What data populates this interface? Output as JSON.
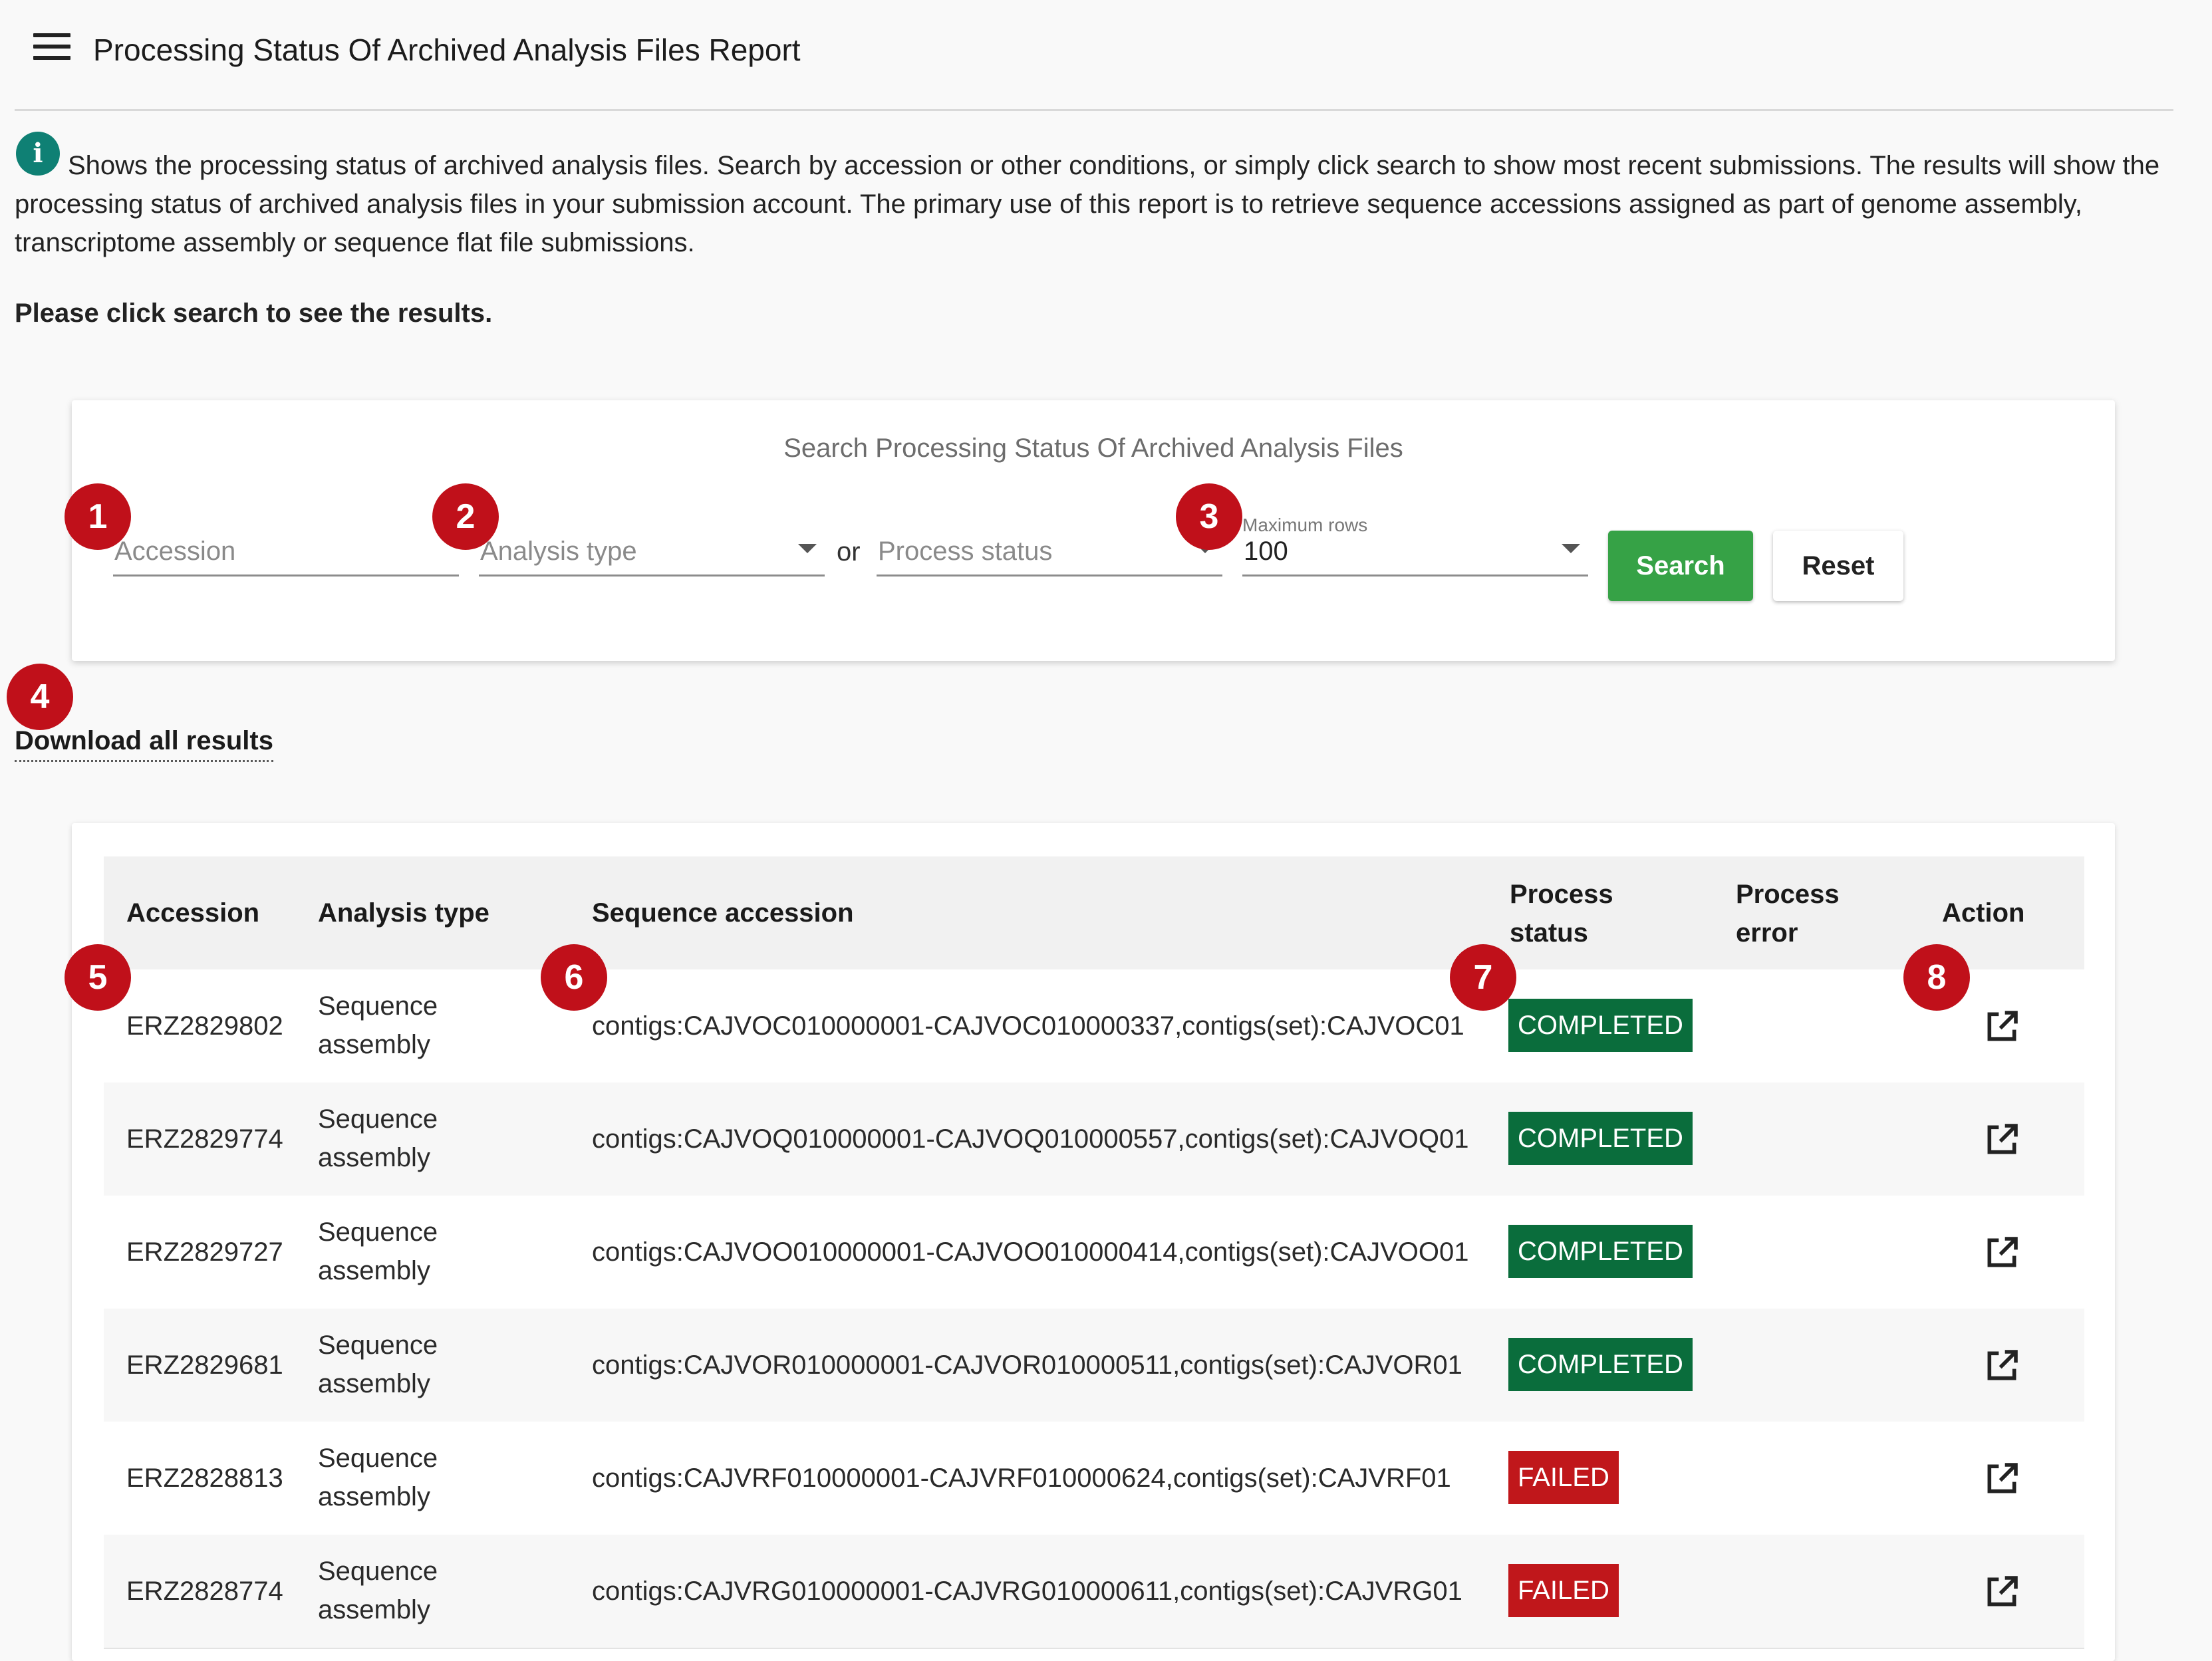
{
  "header": {
    "title": "Processing Status Of Archived Analysis Files Report",
    "menu_icon": "hamburger-menu-icon"
  },
  "intro": {
    "info_icon": "info-icon",
    "description": "Shows the processing status of archived analysis files. Search by accession or other conditions, or simply click search to show most recent submissions. The results will show the processing status of archived analysis files in your submission account. The primary use of this report is to retrieve sequence accessions assigned as part of genome assembly, transcriptome assembly or sequence flat file submissions.",
    "instruction": "Please click search to see the results."
  },
  "search": {
    "title": "Search Processing Status Of Archived Analysis Files",
    "accession_placeholder": "Accession",
    "analysis_type_placeholder": "Analysis type",
    "or_label": "or",
    "process_status_placeholder": "Process status",
    "max_rows_label": "Maximum rows",
    "max_rows_value": "100",
    "search_button": "Search",
    "reset_button": "Reset"
  },
  "download_link": "Download all results",
  "table": {
    "headers": {
      "accession": "Accession",
      "analysis_type": "Analysis type",
      "sequence_accession": "Sequence accession",
      "process_status": "Process status",
      "process_error": "Process error",
      "action": "Action"
    },
    "rows": [
      {
        "accession": "ERZ2829802",
        "analysis_type": "Sequence assembly",
        "sequence_accession": "contigs:CAJVOC010000001-CAJVOC010000337,contigs(set):CAJVOC01",
        "status": "COMPLETED",
        "error": ""
      },
      {
        "accession": "ERZ2829774",
        "analysis_type": "Sequence assembly",
        "sequence_accession": "contigs:CAJVOQ010000001-CAJVOQ010000557,contigs(set):CAJVOQ01",
        "status": "COMPLETED",
        "error": ""
      },
      {
        "accession": "ERZ2829727",
        "analysis_type": "Sequence assembly",
        "sequence_accession": "contigs:CAJVOO010000001-CAJVOO010000414,contigs(set):CAJVOO01",
        "status": "COMPLETED",
        "error": ""
      },
      {
        "accession": "ERZ2829681",
        "analysis_type": "Sequence assembly",
        "sequence_accession": "contigs:CAJVOR010000001-CAJVOR010000511,contigs(set):CAJVOR01",
        "status": "COMPLETED",
        "error": ""
      },
      {
        "accession": "ERZ2828813",
        "analysis_type": "Sequence assembly",
        "sequence_accession": "contigs:CAJVRF010000001-CAJVRF010000624,contigs(set):CAJVRF01",
        "status": "FAILED",
        "error": ""
      },
      {
        "accession": "ERZ2828774",
        "analysis_type": "Sequence assembly",
        "sequence_accession": "contigs:CAJVRG010000001-CAJVRG010000611,contigs(set):CAJVRG01",
        "status": "FAILED",
        "error": ""
      }
    ],
    "action_icon": "open-in-new-icon"
  },
  "markers": [
    "1",
    "2",
    "3",
    "4",
    "5",
    "6",
    "7",
    "8"
  ],
  "colors": {
    "search_button": "#36a246",
    "status_completed": "#0a6d3c",
    "status_failed": "#c0171b",
    "marker": "#c0101a",
    "info_icon": "#0f8074"
  }
}
